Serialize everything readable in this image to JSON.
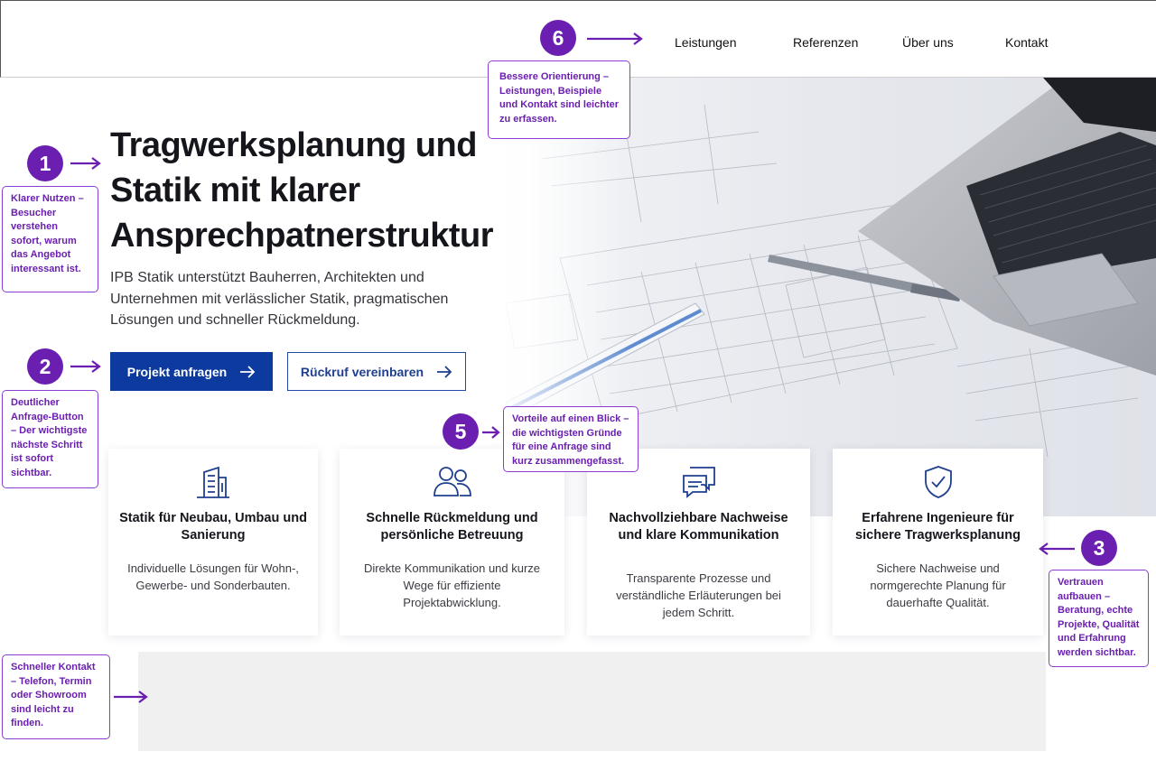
{
  "nav": {
    "items": [
      "Leistungen",
      "Referenzen",
      "Über uns",
      "Kontakt"
    ]
  },
  "hero": {
    "title": "Tragwerksplanung und Statik mit klarer Ansprechpatnerstruktur",
    "subtitle": "IPB Statik unterstützt Bauherren, Architekten und Unternehmen mit verlässlicher Statik, pragmatischen Lösungen und schneller Rückmeldung.",
    "primary_cta": "Projekt anfragen",
    "secondary_cta": "Rückruf vereinbaren"
  },
  "features": [
    {
      "icon": "building-icon",
      "title": "Statik für Neubau, Umbau und Sanierung",
      "text": "Individuelle Lösungen für Wohn-, Gewerbe- und Sonderbauten."
    },
    {
      "icon": "users-icon",
      "title": "Schnelle Rückmeldung und persönliche Betreuung",
      "text": "Direkte Kommunikation und kurze Wege für effiziente Projektabwicklung."
    },
    {
      "icon": "chat-icon",
      "title": "Nachvollziehbare Nachweise und klare Kommunikation",
      "text": "Transparente Prozesse und verständliche Erläuterungen bei jedem Schritt."
    },
    {
      "icon": "shield-check-icon",
      "title": "Erfahrene Ingenieure für sichere Tragwerksplanung",
      "text": "Sichere Nachweise und normgerechte Planung für dauerhafte Qualität."
    }
  ],
  "annotations": [
    {
      "number": "1",
      "text": "Klarer Nutzen – Besucher verstehen sofort, warum das Angebot interessant ist."
    },
    {
      "number": "2",
      "text": "Deutlicher Anfrage-Button – Der wichtigste nächste Schritt ist sofort sichtbar."
    },
    {
      "number": "3",
      "text": "Vertrauen aufbauen – Beratung, echte Projekte, Qualität und Erfahrung werden sichtbar."
    },
    {
      "number": "5",
      "text": "Vorteile auf einen Blick – die wichtigsten Gründe für eine Anfrage sind kurz zusammengefasst."
    },
    {
      "number": "6",
      "text": "Bessere Orientierung – Leistungen, Beispiele und Kontakt sind leichter zu erfassen."
    },
    {
      "number": "",
      "text": "Schneller Kontakt – Telefon, Termin oder Showroom sind leicht zu finden."
    }
  ],
  "colors": {
    "accent_purple": "#6a1fb0",
    "primary_blue": "#0d3a9e",
    "icon_blue": "#1f3f8f"
  }
}
